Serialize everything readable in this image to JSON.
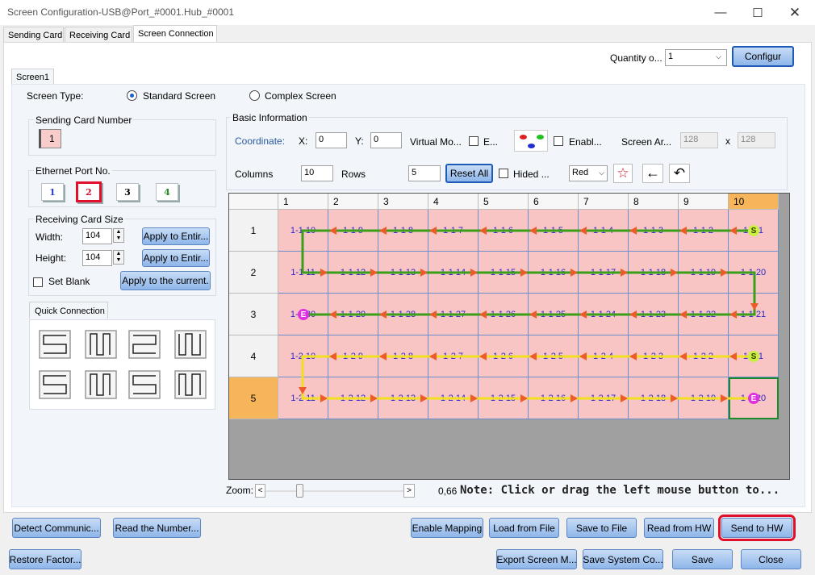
{
  "window": {
    "title": "Screen Configuration-USB@Port_#0001.Hub_#0001"
  },
  "tabs": [
    "Sending Card",
    "Receiving Card",
    "Screen Connection"
  ],
  "quantity": {
    "label": "Quantity o...",
    "value": "1",
    "configure": "Configur"
  },
  "screen_tab": "Screen1",
  "screen_type": {
    "label": "Screen Type:",
    "standard": "Standard Screen",
    "complex": "Complex Screen"
  },
  "sending_card": {
    "label": "Sending Card Number",
    "value": "1"
  },
  "ethernet": {
    "label": "Ethernet Port No.",
    "ports": [
      "1",
      "2",
      "3",
      "4"
    ]
  },
  "rcv_size": {
    "label": "Receiving Card Size",
    "width_label": "Width:",
    "width": "104",
    "height_label": "Height:",
    "height": "104",
    "apply_entire": "Apply to Entir...",
    "set_blank": "Set Blank",
    "apply_current": "Apply to the current."
  },
  "quick": {
    "label": "Quick Connection"
  },
  "basic": {
    "label": "Basic Information",
    "coordinate": "Coordinate:",
    "x_label": "X:",
    "x": "0",
    "y_label": "Y:",
    "y": "0",
    "virtual": "Virtual Mo...",
    "e_label": "E...",
    "enable_label": "Enabl...",
    "screen_area": "Screen Ar...",
    "area_w": "128",
    "area_x": "x",
    "area_h": "128",
    "columns_label": "Columns",
    "columns": "10",
    "rows_label": "Rows",
    "rows": "5",
    "reset_all": "Reset All",
    "hided": "Hided ...",
    "color": "Red"
  },
  "grid": {
    "col_headers": [
      "1",
      "2",
      "3",
      "4",
      "5",
      "6",
      "7",
      "8",
      "9",
      "10"
    ],
    "row_headers": [
      "1",
      "2",
      "3",
      "4",
      "5"
    ],
    "cells": [
      [
        "1-1 10",
        "1-1 9",
        "1-1 8",
        "1-1 7",
        "1-1 6",
        "1-1 5",
        "1-1 4",
        "1-1 3",
        "1-1 2",
        "1-1 1"
      ],
      [
        "1-1 11",
        "1-1 12",
        "1-1 13",
        "1-1 14",
        "1-1 15",
        "1-1 16",
        "1-1 17",
        "1-1 18",
        "1-1 19",
        "1-1 20"
      ],
      [
        "1-1 30",
        "1-1 29",
        "1-1 28",
        "1-1 27",
        "1-1 26",
        "1-1 25",
        "1-1 24",
        "1-1 23",
        "1-1 22",
        "1-1 21"
      ],
      [
        "1-2 10",
        "1-2 9",
        "1-2 8",
        "1-2 7",
        "1-2 6",
        "1-2 5",
        "1-2 4",
        "1-2 3",
        "1-2 2",
        "1-2 1"
      ],
      [
        "1-2 11",
        "1-2 12",
        "1-2 13",
        "1-2 14",
        "1-2 15",
        "1-2 16",
        "1-2 17",
        "1-2 18",
        "1-2 19",
        "1-2 20"
      ]
    ],
    "start_mark": "S",
    "end_mark": "E",
    "colors": {
      "path1": "#3aa01a",
      "path2": "#f0e020",
      "arrow": "#ee5a2a",
      "selected_header": "#f7b55b"
    }
  },
  "zoom": {
    "label": "Zoom:",
    "left": "<",
    "right": ">",
    "value": "0,66",
    "note": "Note: Click or drag the left mouse button to..."
  },
  "buttons_row1": {
    "detect": "Detect Communic...",
    "read_number": "Read the Number...",
    "enable_mapping": "Enable Mapping",
    "load_file": "Load from File",
    "save_file": "Save to File",
    "read_hw": "Read from HW",
    "send_hw": "Send to HW"
  },
  "buttons_row2": {
    "restore": "Restore Factor...",
    "export": "Export Screen M...",
    "save_system": "Save System Co...",
    "save": "Save",
    "close": "Close"
  }
}
